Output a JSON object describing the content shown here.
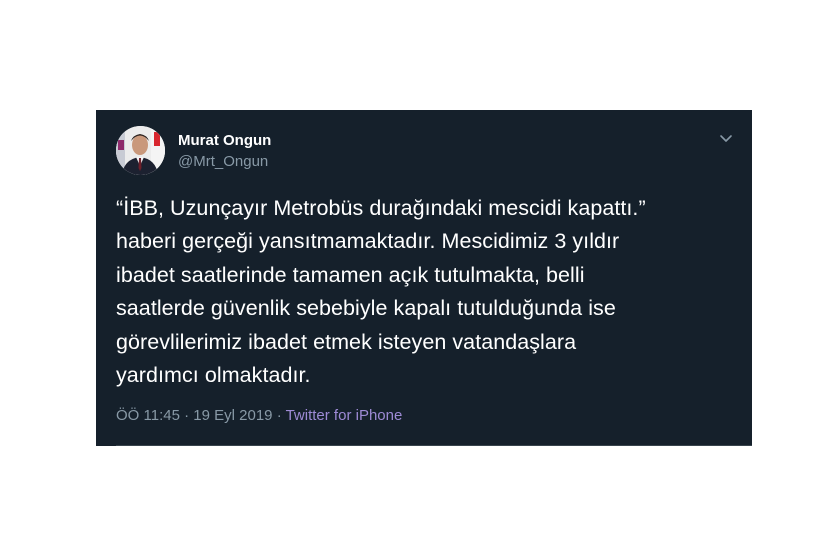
{
  "tweet": {
    "author": {
      "display_name": "Murat Ongun",
      "handle": "@Mrt_Ongun"
    },
    "text_lines": [
      "“İBB, Uzunçayır Metrobüs durağındaki mescidi kapattı.”",
      "haberi gerçeği yansıtmamaktadır. Mescidimiz 3 yıldır",
      "ibadet saatlerinde tamamen açık tutulmakta, belli",
      "saatlerde güvenlik sebebiyle kapalı tutulduğunda ise",
      "görevlilerimiz ibadet etmek isteyen vatandaşlara",
      "yardımcı olmaktadır."
    ],
    "time": "ÖÖ 11:45",
    "separator": "·",
    "date": "19 Eyl 2019",
    "source": "Twitter for iPhone"
  },
  "colors": {
    "card_background": "#15202b",
    "text_primary": "#ffffff",
    "text_secondary": "#8899a6",
    "source_link": "#9e8bd6"
  },
  "icons": {
    "menu": "chevron-down-icon",
    "avatar": "avatar-photo"
  }
}
